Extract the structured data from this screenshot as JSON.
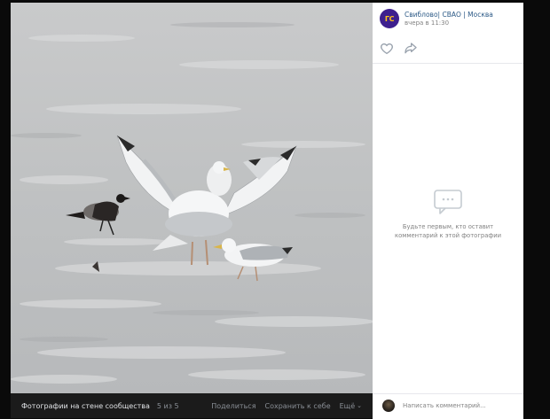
{
  "post": {
    "author": "Свиблово| СВАО | Москва",
    "avatar_text": "ГС",
    "time": "вчера в 11:30"
  },
  "icons": {
    "like": "heart-icon",
    "share": "share-arrow-icon",
    "empty": "comments-bubble-icon"
  },
  "comments": {
    "empty_text": "Будьте первым, кто оставит комментарий к этой фотографии",
    "placeholder": "Написать комментарий..."
  },
  "bottom_bar": {
    "album": "Фотографии на стене сообщества",
    "counter": "5 из 5",
    "share": "Поделиться",
    "save": "Сохранить к себе",
    "more": "Ещё",
    "more_chevron": "⌄"
  },
  "colors": {
    "avatar_bg": "#3d1f8e",
    "avatar_text": "#ffc21a",
    "link": "#2a5885",
    "muted": "#828282"
  }
}
